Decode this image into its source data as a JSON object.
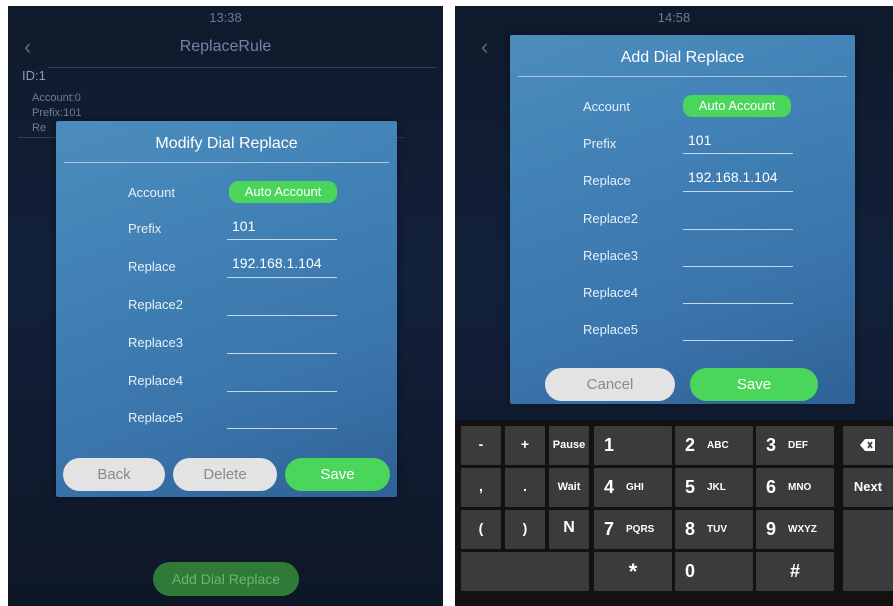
{
  "left": {
    "status_time": "13:38",
    "title": "ReplaceRule",
    "rule": {
      "id": "ID:1",
      "account": "Account:0",
      "prefix": "Prefix:101",
      "replace_partial": "Re"
    },
    "dialog": {
      "title": "Modify Dial Replace",
      "fields": [
        {
          "label": "Account",
          "value": "Auto Account"
        },
        {
          "label": "Prefix",
          "value": "101"
        },
        {
          "label": "Replace",
          "value": "192.168.1.104"
        },
        {
          "label": "Replace2",
          "value": ""
        },
        {
          "label": "Replace3",
          "value": ""
        },
        {
          "label": "Replace4",
          "value": ""
        },
        {
          "label": "Replace5",
          "value": ""
        }
      ],
      "buttons": {
        "back": "Back",
        "delete": "Delete",
        "save": "Save"
      }
    },
    "add_button": "Add Dial Replace"
  },
  "right": {
    "status_time": "14:58",
    "dialog": {
      "title": "Add Dial Replace",
      "fields": [
        {
          "label": "Account",
          "value": "Auto Account"
        },
        {
          "label": "Prefix",
          "value": "101"
        },
        {
          "label": "Replace",
          "value": "192.168.1.104"
        },
        {
          "label": "Replace2",
          "value": ""
        },
        {
          "label": "Replace3",
          "value": ""
        },
        {
          "label": "Replace4",
          "value": ""
        },
        {
          "label": "Replace5",
          "value": ""
        }
      ],
      "buttons": {
        "cancel": "Cancel",
        "save": "Save"
      }
    },
    "keyboard": {
      "row1": [
        "-",
        "+",
        "Pause"
      ],
      "row2": [
        ",",
        ".",
        "Wait"
      ],
      "row3": [
        "(",
        ")",
        "N"
      ],
      "digits": [
        {
          "num": "1",
          "letters": ""
        },
        {
          "num": "2",
          "letters": "ABC"
        },
        {
          "num": "3",
          "letters": "DEF"
        },
        {
          "num": "4",
          "letters": "GHI"
        },
        {
          "num": "5",
          "letters": "JKL"
        },
        {
          "num": "6",
          "letters": "MNO"
        },
        {
          "num": "7",
          "letters": "PQRS"
        },
        {
          "num": "8",
          "letters": "TUV"
        },
        {
          "num": "9",
          "letters": "WXYZ"
        }
      ],
      "star": "*",
      "zero": "0",
      "hash": "#",
      "backspace_icon": "backspace-icon",
      "next": "Next"
    }
  }
}
